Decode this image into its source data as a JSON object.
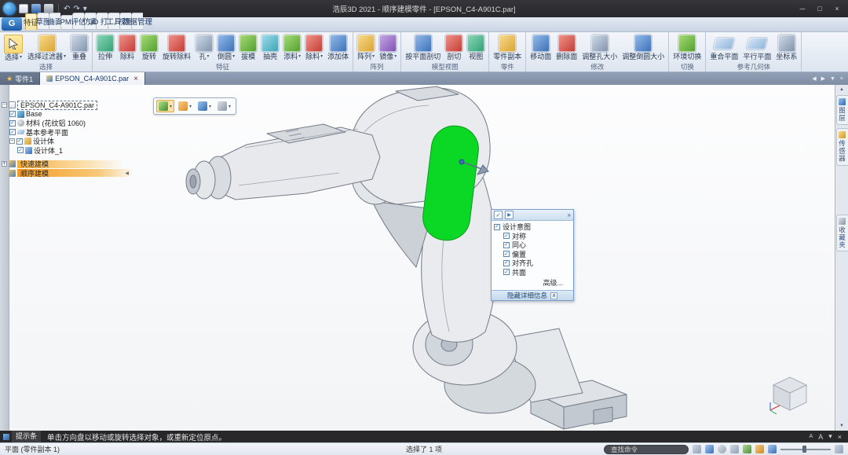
{
  "icons": {
    "caret": "▾",
    "check": "✓",
    "plus": "+",
    "minus": "−",
    "close": "×",
    "min": "─",
    "max": "□",
    "tab_close": "×",
    "arrow_left": "◀",
    "arrow_right": "▶",
    "arrow_down": "▼",
    "arrow_up": "▲",
    "play": "▶",
    "dock": "»",
    "chevron_up": "∧",
    "star": "★",
    "undo": "↶",
    "redo": "↷",
    "logo": "G",
    "letter": "A"
  },
  "titlebar": {
    "title": "浩辰3D 2021 - 顺序建模零件 - [EPSON_C4-A901C.par]"
  },
  "ribbon_tabs": [
    {
      "label": "特征"
    },
    {
      "label": "草图"
    },
    {
      "label": "曲面"
    },
    {
      "label": "PMI"
    },
    {
      "label": "评估"
    },
    {
      "label": "仿真"
    },
    {
      "label": "3D 打印"
    },
    {
      "label": "工具"
    },
    {
      "label": "视图"
    },
    {
      "label": "数据管理"
    }
  ],
  "ribbon": {
    "groups": [
      {
        "caption": "选择",
        "items": [
          {
            "label": "选择"
          },
          {
            "label": "选择过滤器"
          },
          {
            "label": "重叠"
          }
        ]
      },
      {
        "caption": "特征",
        "items": [
          {
            "label": "拉伸"
          },
          {
            "label": "除料"
          },
          {
            "label": "旋转"
          },
          {
            "label": "旋转除料"
          },
          {
            "label": "孔"
          },
          {
            "label": "倒圆"
          },
          {
            "label": "拔模"
          },
          {
            "label": "抽壳"
          },
          {
            "label": "添料"
          },
          {
            "label": "除料"
          },
          {
            "label": "添加体"
          }
        ]
      },
      {
        "caption": "阵列",
        "items": [
          {
            "label": "阵列"
          },
          {
            "label": "镜像"
          }
        ]
      },
      {
        "caption": "模型视图",
        "items": [
          {
            "label": "按平面剖切"
          },
          {
            "label": "剖切"
          },
          {
            "label": "视图"
          }
        ]
      },
      {
        "caption": "零件",
        "items": [
          {
            "label": "零件副本"
          }
        ]
      },
      {
        "caption": "修改",
        "items": [
          {
            "label": "移动面"
          },
          {
            "label": "删除面"
          },
          {
            "label": "调整孔大小"
          },
          {
            "label": "调整倒圆大小"
          }
        ]
      },
      {
        "caption": "切换",
        "items": [
          {
            "label": "环境切换"
          }
        ]
      },
      {
        "caption": "参考几何体",
        "items": [
          {
            "label": "重合平面"
          },
          {
            "label": "平行平面"
          },
          {
            "label": "坐标系"
          }
        ]
      }
    ]
  },
  "doc_tabs": [
    {
      "label": "零件1"
    },
    {
      "label": "EPSON_C4-A901C.par"
    }
  ],
  "pathfinder": {
    "root": "EPSON_C4-A901C.par",
    "items": [
      {
        "label": "Base"
      },
      {
        "label": "材料 (花纹铝 1060)"
      },
      {
        "label": "基本参考平面"
      },
      {
        "label": "设计体"
      },
      {
        "label": "设计体_1"
      }
    ],
    "modes": [
      {
        "label": "快速建模"
      },
      {
        "label": "顺序建模"
      }
    ]
  },
  "design_intent": {
    "title": "设计意图",
    "options": [
      "对称",
      "同心",
      "偏置",
      "对齐孔",
      "共面"
    ],
    "advanced": "高级...",
    "footer": "隐藏详细信息"
  },
  "right_tabs": [
    {
      "label": "图层"
    },
    {
      "label": "传感器"
    },
    {
      "label": "收藏夹"
    }
  ],
  "prompt_bar": {
    "label": "提示条",
    "message": "单击方向盘以移动或旋转选择对象，或重新定位原点。"
  },
  "status_bar": {
    "context": "平面 (零件副本 1)",
    "selection": "选择了 1 项",
    "search_placeholder": "查找命令"
  }
}
